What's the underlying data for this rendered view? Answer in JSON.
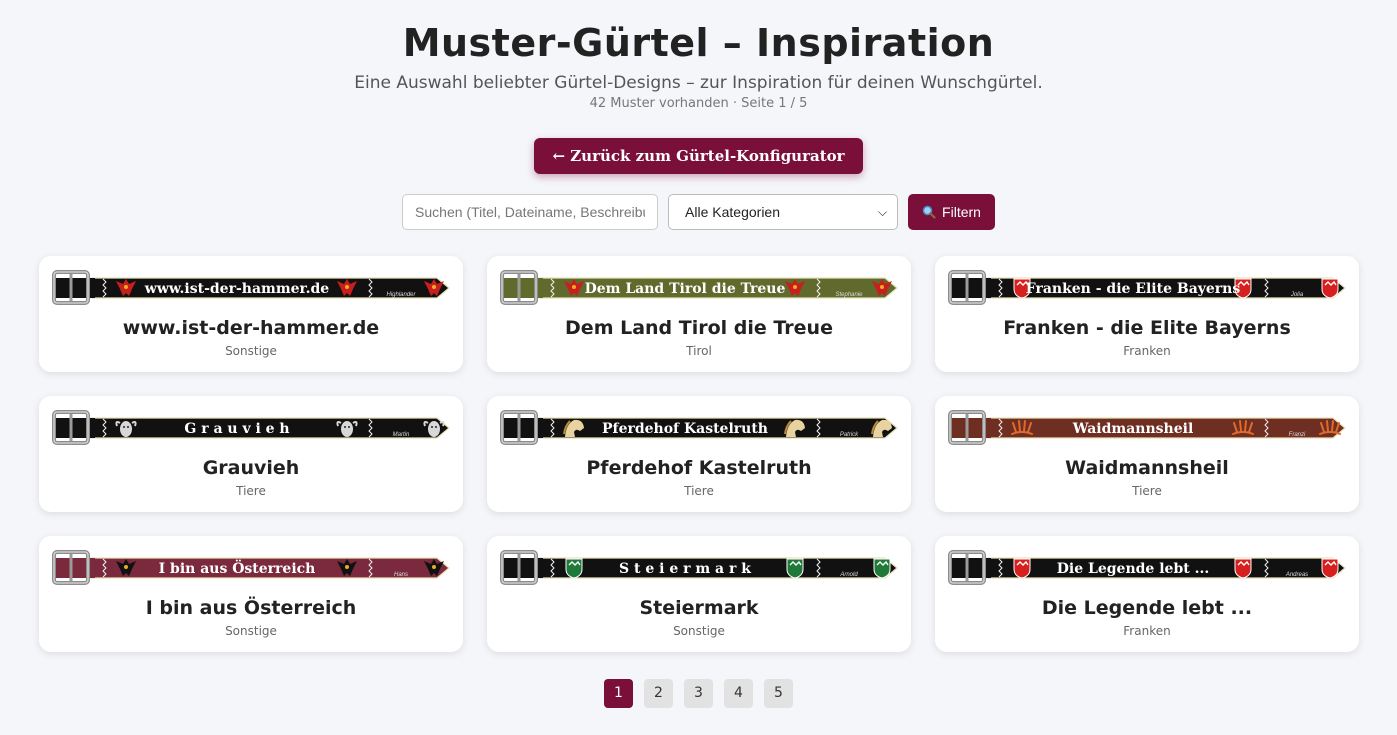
{
  "header": {
    "title": "Muster-Gürtel – Inspiration",
    "subtitle": "Eine Auswahl beliebter Gürtel-Designs – zur Inspiration für deinen Wunschgürtel.",
    "meta": "42 Muster vorhanden · Seite 1 / 5"
  },
  "back_button": {
    "label": "← Zurück zum Gürtel-Konfigurator"
  },
  "filters": {
    "search_placeholder": "Suchen (Titel, Dateiname, Beschreibung)",
    "category_selected": "Alle Kategorien",
    "filter_button": "Filtern",
    "filter_icon": "magnifier-icon"
  },
  "colors": {
    "accent": "#7a0f3a"
  },
  "cards": [
    {
      "title": "www.ist-der-hammer.de",
      "category": "Sonstige",
      "belt_text": "www.ist-der-hammer.de",
      "belt_name": "Highlander",
      "belt_color": "#111111",
      "emblem": "eagle",
      "emblem_color": "#c81e1e"
    },
    {
      "title": "Dem Land Tirol die Treue",
      "category": "Tirol",
      "belt_text": "Dem Land Tirol die Treue",
      "belt_name": "Stephanie",
      "belt_color": "#5f6a2c",
      "emblem": "eagle",
      "emblem_color": "#c81e1e"
    },
    {
      "title": "Franken - die Elite Bayerns",
      "category": "Franken",
      "belt_text": "Franken - die Elite Bayerns",
      "belt_name": "Jolia",
      "belt_color": "#111111",
      "emblem": "shield",
      "emblem_color": "#d62020"
    },
    {
      "title": "Grauvieh",
      "category": "Tiere",
      "belt_text": "G r a u v i e h",
      "belt_name": "Martin",
      "belt_color": "#111111",
      "emblem": "cow",
      "emblem_color": "#d8d8d8"
    },
    {
      "title": "Pferdehof Kastelruth",
      "category": "Tiere",
      "belt_text": "Pferdehof Kastelruth",
      "belt_name": "Patrick",
      "belt_color": "#111111",
      "emblem": "horse",
      "emblem_color": "#e8d3a0"
    },
    {
      "title": "Waidmannsheil",
      "category": "Tiere",
      "belt_text": "Waidmannsheil",
      "belt_name": "Franzi",
      "belt_color": "#6e2e22",
      "emblem": "antler",
      "emblem_color": "#e06a2a"
    },
    {
      "title": "I bin aus Österreich",
      "category": "Sonstige",
      "belt_text": "I bin aus Österreich",
      "belt_name": "Hans",
      "belt_color": "#7a2a3c",
      "emblem": "eagle",
      "emblem_color": "#111111"
    },
    {
      "title": "Steiermark",
      "category": "Sonstige",
      "belt_text": "S t e i e r m a r k",
      "belt_name": "Arnold",
      "belt_color": "#111111",
      "emblem": "shield",
      "emblem_color": "#1f7a3a"
    },
    {
      "title": "Die Legende lebt ...",
      "category": "Franken",
      "belt_text": "Die Legende lebt ...",
      "belt_name": "Andreas",
      "belt_color": "#111111",
      "emblem": "shield",
      "emblem_color": "#d62020"
    }
  ],
  "pagination": {
    "pages": [
      "1",
      "2",
      "3",
      "4",
      "5"
    ],
    "current": "1"
  }
}
